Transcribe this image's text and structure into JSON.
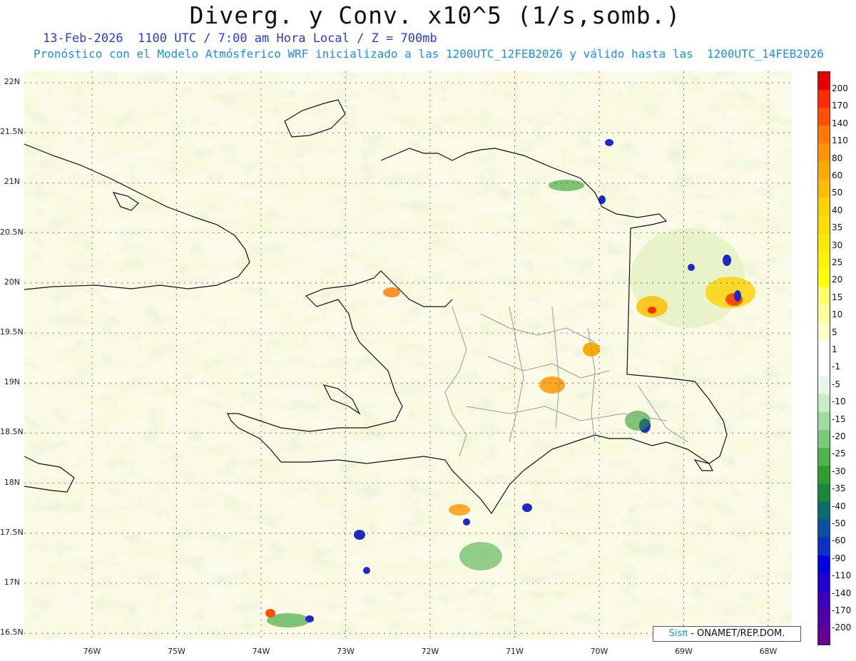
{
  "title": "Diverg. y Conv. x10^5 (1/s,somb.)",
  "subtitle_line1": "13-Feb-2026  1100 UTC / 7:00 am Hora Local / Z = 700mb",
  "subtitle_line2": "Pronóstico con el Modelo Atmósferico WRF inicializado a las 1200UTC_12FEB2026 y válido hasta las  1200UTC_14FEB2026",
  "latitude_labels": [
    "22N",
    "21.5N",
    "21N",
    "20.5N",
    "20N",
    "19.5N",
    "19N",
    "18.5N",
    "18N",
    "17.5N",
    "17N",
    "16.5N"
  ],
  "longitude_labels": [
    "76W",
    "75W",
    "74W",
    "73W",
    "72W",
    "71W",
    "70W",
    "69W",
    "68W"
  ],
  "colorbar": {
    "labels": [
      "200",
      "170",
      "140",
      "110",
      "80",
      "60",
      "50",
      "40",
      "35",
      "30",
      "25",
      "20",
      "15",
      "10",
      "5",
      "1",
      "-1",
      "-5",
      "-10",
      "-15",
      "-20",
      "-25",
      "-30",
      "-35",
      "-40",
      "-50",
      "-60",
      "-90",
      "-110",
      "-140",
      "-170",
      "-200"
    ],
    "colors": [
      "#e60000",
      "#ff2a00",
      "#ff5000",
      "#ff7800",
      "#ff9600",
      "#ffaa00",
      "#ffbe00",
      "#ffd200",
      "#ffdc00",
      "#ffe600",
      "#fff000",
      "#ffff00",
      "#ffff66",
      "#ffff99",
      "#ffffcc",
      "#ffffff",
      "#ffffff",
      "#e8f5e8",
      "#c8ecc8",
      "#a0dca0",
      "#78cc78",
      "#50b450",
      "#2ca02c",
      "#148c3c",
      "#0a6e6e",
      "#0a50a0",
      "#0a32c8",
      "#0000e6",
      "#1e00d2",
      "#3c00be",
      "#5000aa",
      "#640096"
    ]
  },
  "map_colors": {
    "background": "#fbfbe9",
    "grid": "#555555",
    "coast": "#111111",
    "provinces": "#9a9a9a"
  },
  "credit": {
    "brand": "Sis",
    "pi": "π",
    "text": " - ONAMET/REP.DOM."
  }
}
